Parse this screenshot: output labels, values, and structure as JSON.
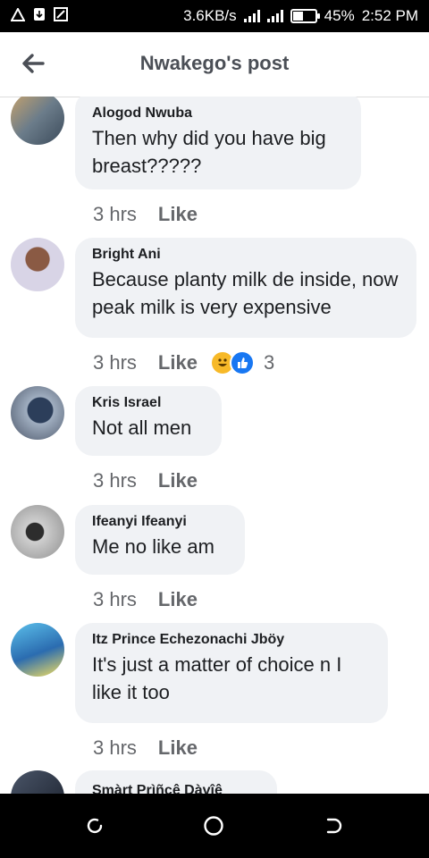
{
  "status": {
    "speed": "3.6KB/s",
    "battery": "45%",
    "time": "2:52 PM"
  },
  "header": {
    "title": "Nwakego's post"
  },
  "comments": [
    {
      "name": "Alogod Nwuba",
      "text": "Then why did you have big breast?????",
      "time": "3 hrs",
      "like": "Like"
    },
    {
      "name": "Bright Ani",
      "text": "Because planty milk de inside, now peak milk is very expensive",
      "time": "3 hrs",
      "like": "Like",
      "reaction_count": "3"
    },
    {
      "name": "Kris Israel",
      "text": "Not all men",
      "time": "3 hrs",
      "like": "Like"
    },
    {
      "name": "Ifeanyi Ifeanyi",
      "text": "Me no like am",
      "time": "3 hrs",
      "like": "Like"
    },
    {
      "name": "Itz Prince Echezonachi Jböy",
      "text": "It's just a matter of choice n I like it too",
      "time": "3 hrs",
      "like": "Like"
    },
    {
      "name": "Smàrt Prìñcê Dàvîê"
    }
  ],
  "colors": {
    "bubble": "#f0f2f5",
    "meta": "#65676b",
    "like_react": "#1877f2",
    "haha_react": "#f7b928"
  },
  "icons": [
    "back-arrow-icon",
    "haha-reaction-icon",
    "like-reaction-icon",
    "recent-apps-icon",
    "home-icon",
    "back-icon"
  ]
}
